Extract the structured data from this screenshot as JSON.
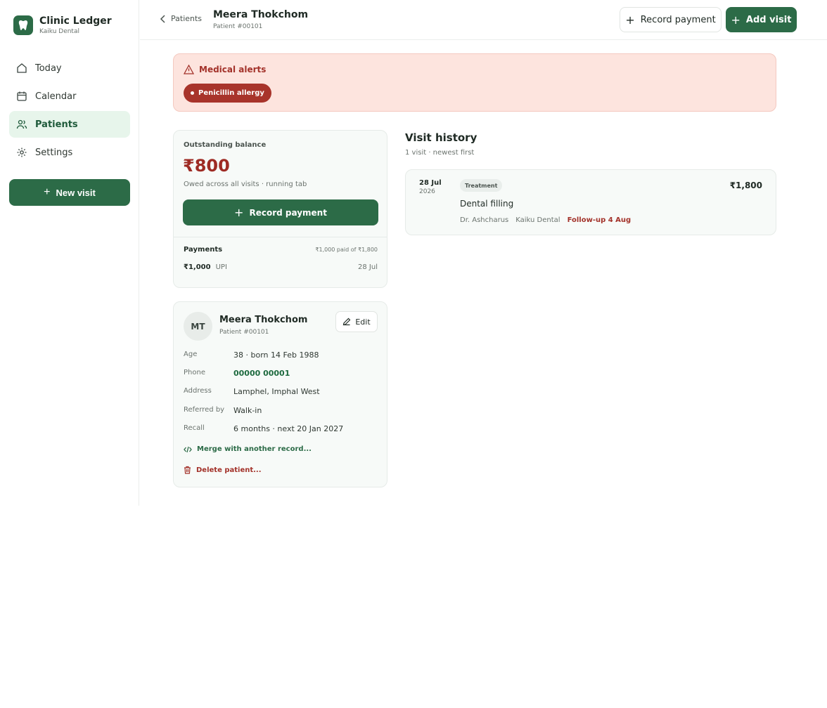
{
  "app": {
    "title": "Clinic Ledger",
    "clinic": "Kaiku Dental"
  },
  "sidebar": {
    "items": [
      {
        "label": "Today",
        "icon": "home-icon"
      },
      {
        "label": "Calendar",
        "icon": "calendar-icon"
      },
      {
        "label": "Patients",
        "icon": "users-icon",
        "active": true
      },
      {
        "label": "Settings",
        "icon": "gear-icon"
      }
    ],
    "new_visit_label": "New visit"
  },
  "header": {
    "back_label": "Patients",
    "patient_name": "Meera Thokchom",
    "patient_id": "Patient #00101",
    "record_payment_label": "Record payment",
    "add_visit_label": "Add visit"
  },
  "alerts": {
    "title": "Medical alerts",
    "items": [
      "Penicillin allergy"
    ]
  },
  "balance": {
    "label": "Outstanding balance",
    "amount": "₹800",
    "subtitle": "Owed across all visits · running tab",
    "record_payment_label": "Record payment",
    "payments_title": "Payments",
    "payments_summary": "₹1,000 paid of ₹1,800",
    "payments": [
      {
        "amount": "₹1,000",
        "method": "UPI",
        "date": "28 Jul"
      }
    ]
  },
  "patient": {
    "initials": "MT",
    "name": "Meera Thokchom",
    "id": "Patient #00101",
    "edit_label": "Edit",
    "fields": [
      {
        "label": "Age",
        "value": "38 · born 14 Feb 1988"
      },
      {
        "label": "Phone",
        "value": "00000 00001"
      },
      {
        "label": "Address",
        "value": "Lamphel, Imphal West"
      },
      {
        "label": "Referred by",
        "value": "Walk-in"
      },
      {
        "label": "Recall",
        "value": "6 months · next 20 Jan 2027"
      }
    ],
    "merge_label": "Merge with another record...",
    "delete_label": "Delete patient..."
  },
  "visit_history": {
    "title": "Visit history",
    "subtitle": "1 visit · newest first",
    "visits": [
      {
        "date": "28 Jul",
        "year": "2026",
        "tag": "Treatment",
        "description": "Dental filling",
        "doctor": "Dr. Ashcharus",
        "clinic": "Kaiku Dental",
        "follow_up": "Follow-up 4 Aug",
        "amount": "₹1,800"
      }
    ]
  },
  "colors": {
    "brand": "#2c6b47",
    "danger": "#a3322a",
    "alert_bg": "#fde4de",
    "active_nav_bg": "#e7f5eb"
  }
}
